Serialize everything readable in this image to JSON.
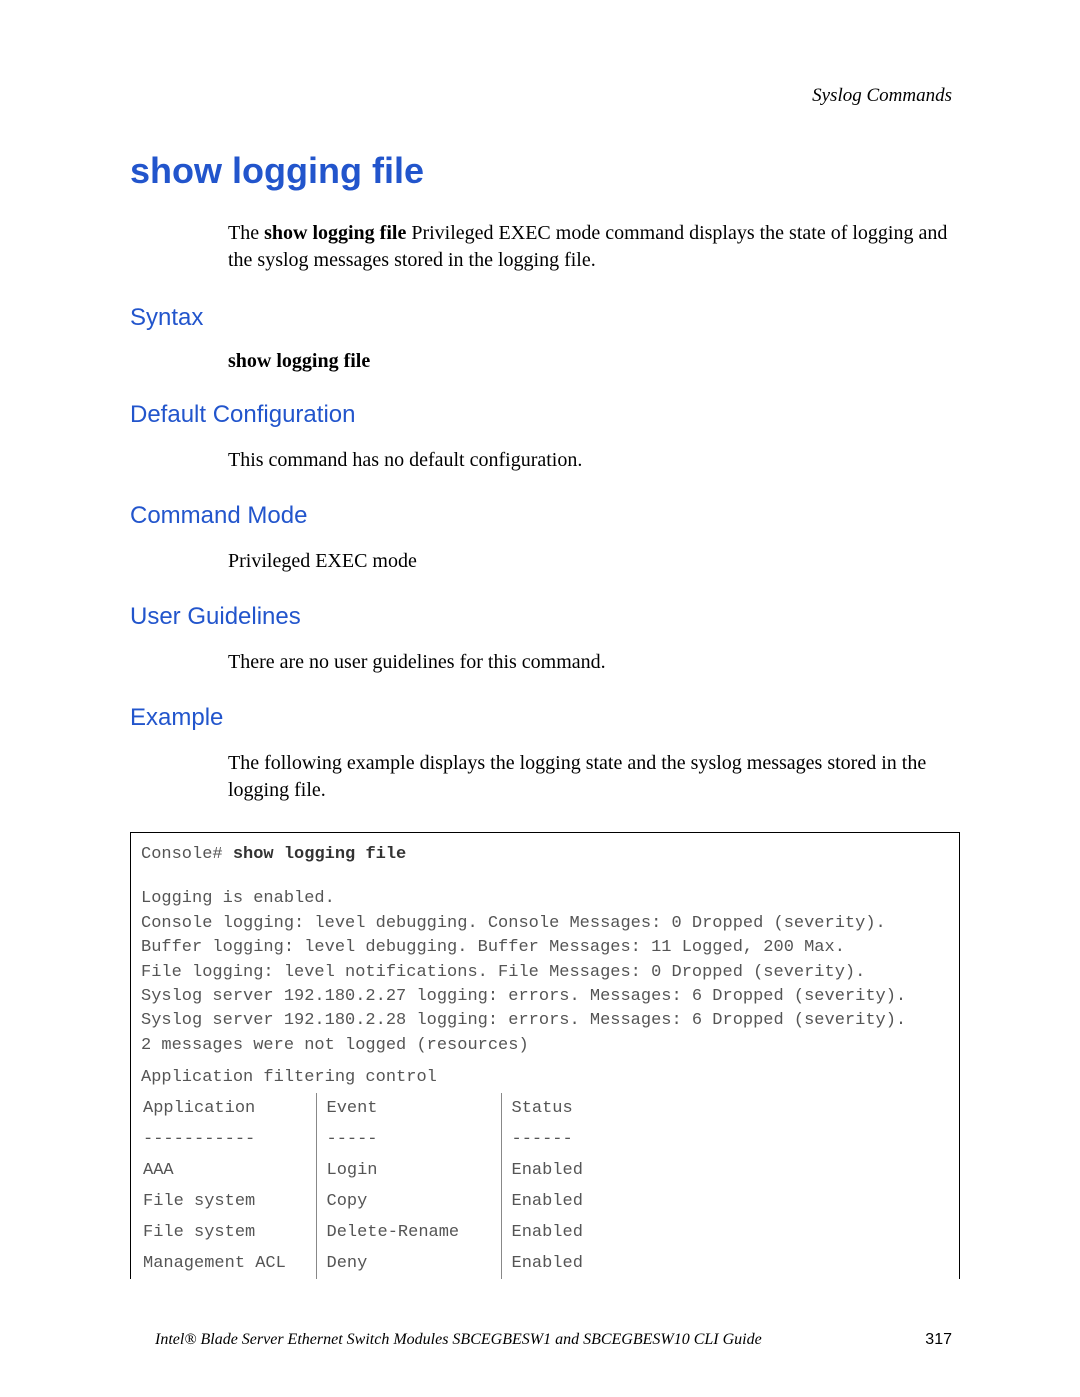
{
  "header": {
    "section": "Syslog Commands"
  },
  "title": "show logging file",
  "intro": {
    "prefix": "The ",
    "cmd": "show logging file",
    "rest": " Privileged EXEC mode command displays the state of logging and the syslog messages stored in the logging file."
  },
  "sections": {
    "syntax": {
      "heading": "Syntax",
      "text": "show logging file"
    },
    "default_config": {
      "heading": "Default Configuration",
      "text": "This command has no default configuration."
    },
    "command_mode": {
      "heading": "Command Mode",
      "text": "Privileged EXEC mode"
    },
    "user_guidelines": {
      "heading": "User Guidelines",
      "text": "There are no user guidelines for this command."
    },
    "example": {
      "heading": "Example",
      "text": "The following example displays the logging state and the syslog messages stored in the logging file."
    }
  },
  "console": {
    "prompt": "Console# ",
    "command": "show logging file",
    "lines": [
      "Logging is enabled.",
      "Console logging: level debugging. Console Messages: 0 Dropped (severity).",
      "Buffer logging: level debugging. Buffer Messages: 11 Logged, 200 Max.",
      "File logging: level notifications. File Messages: 0 Dropped (severity).",
      "Syslog server 192.180.2.27 logging: errors. Messages: 6 Dropped (severity).",
      "Syslog server 192.180.2.28 logging: errors. Messages: 6 Dropped (severity).",
      "2 messages were not logged (resources)"
    ]
  },
  "filter": {
    "title": "Application filtering control",
    "headers": {
      "c1": "Application",
      "c2": "Event",
      "c3": "Status"
    },
    "dashes": {
      "c1": "-----------",
      "c2": "-----",
      "c3": "------"
    },
    "rows": [
      {
        "c1": "AAA",
        "c2": "Login",
        "c3": "Enabled"
      },
      {
        "c1": "File system",
        "c2": "Copy",
        "c3": "Enabled"
      },
      {
        "c1": "File system",
        "c2": "Delete-Rename",
        "c3": "Enabled"
      },
      {
        "c1": "Management ACL",
        "c2": "Deny",
        "c3": "Enabled"
      }
    ]
  },
  "footer": {
    "text": "Intel® Blade Server Ethernet Switch Modules SBCEGBESW1 and SBCEGBESW10 CLI Guide",
    "page": "317"
  }
}
